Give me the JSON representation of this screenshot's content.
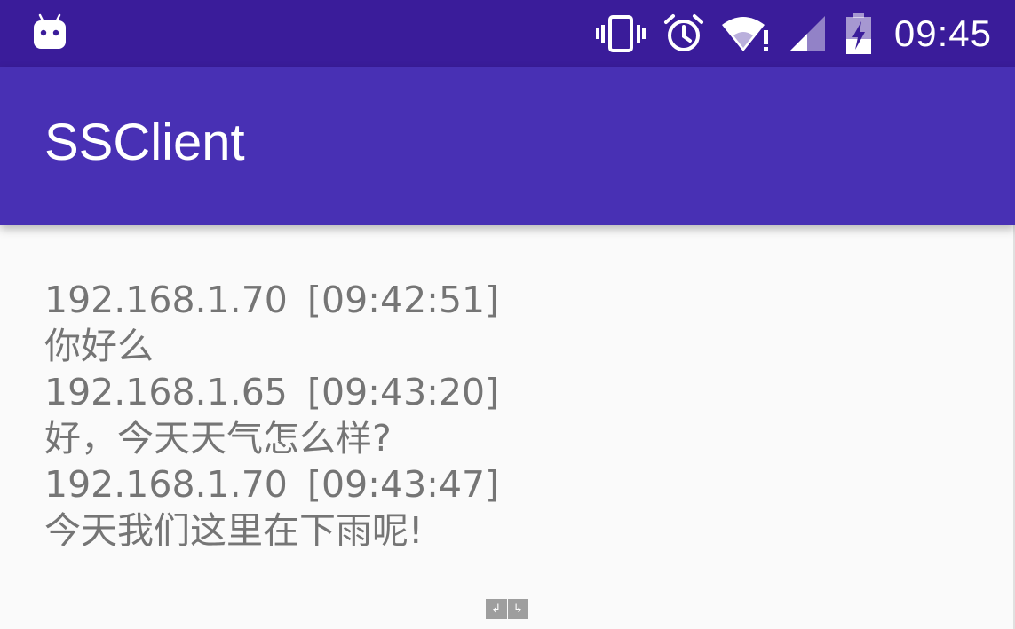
{
  "status_bar": {
    "icons": [
      "android-notification-icon",
      "vibrate-icon",
      "alarm-icon",
      "wifi-icon",
      "cell-signal-icon",
      "battery-charging-icon"
    ],
    "time": "09:45"
  },
  "app_bar": {
    "title": "SSClient"
  },
  "messages": [
    {
      "ip": "192.168.1.70",
      "time": "[09:42:51]",
      "text": "你好么"
    },
    {
      "ip": "192.168.1.65",
      "time": "[09:43:20]",
      "text": "好，今天天气怎么样?"
    },
    {
      "ip": "192.168.1.70",
      "time": "[09:43:47]",
      "text": "今天我们这里在下雨呢!"
    }
  ],
  "drag_handle": {
    "left_glyph": "↲",
    "right_glyph": "↳"
  },
  "colors": {
    "status_bar": "#3a1c9a",
    "app_bar": "#4830b4",
    "background": "#fafafa",
    "message_text": "#757575"
  }
}
